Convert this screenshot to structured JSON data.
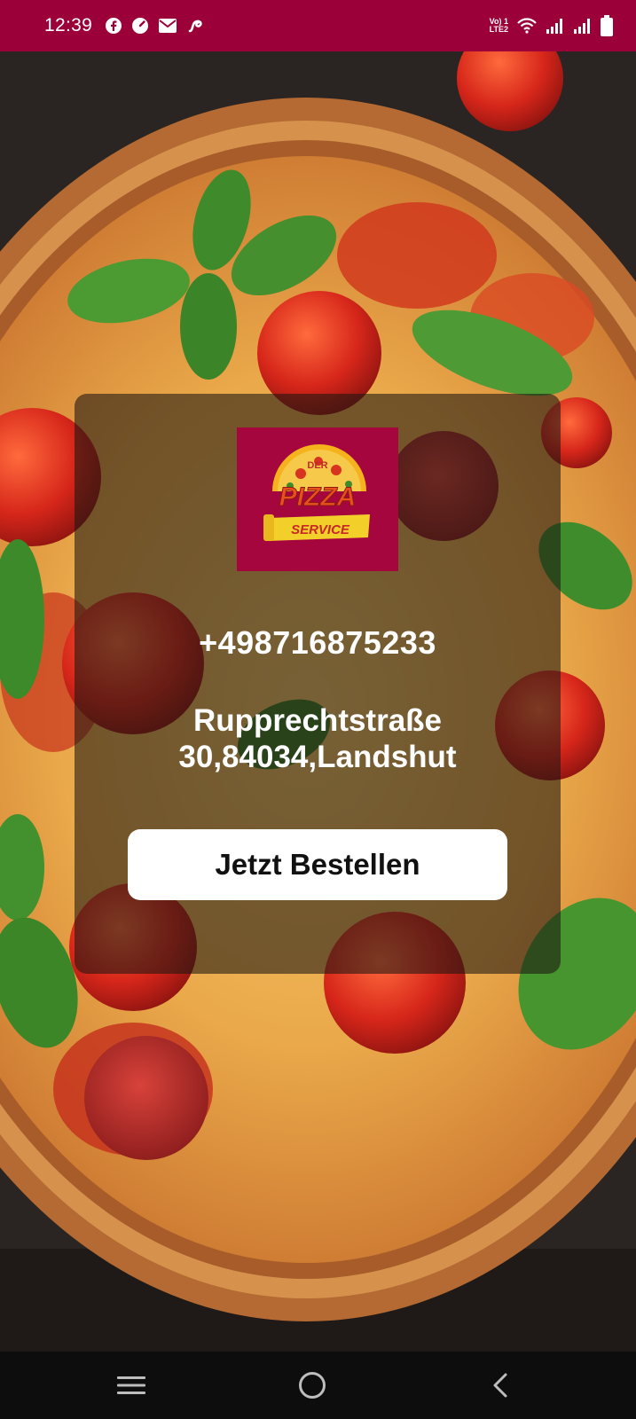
{
  "status_bar": {
    "time": "12:39",
    "notification_icons": [
      "facebook-icon",
      "speedometer-icon",
      "mail-icon",
      "swirl-app-icon"
    ],
    "network_label": "Vo) 1\nLTE2",
    "system_icons": [
      "wifi-icon",
      "signal-icon",
      "signal-icon",
      "battery-icon"
    ],
    "background_color": "#9b0038"
  },
  "logo": {
    "top_text": "DER",
    "brand_text": "PIZZA",
    "sub_text": "SERVICE",
    "background_color": "#a6063e"
  },
  "contact": {
    "phone": "+498716875233",
    "address_line1": "Rupprechtstraße",
    "address_line2": "30,84034,Landshut"
  },
  "order_button": {
    "label": "Jetzt Bestellen"
  },
  "nav_bar": {
    "buttons": [
      "menu-icon",
      "home-icon",
      "back-icon"
    ]
  },
  "colors": {
    "brand": "#9b0038",
    "card_overlay": "rgba(30,22,18,0.58)",
    "button_bg": "#ffffff",
    "text_light": "#ffffff"
  }
}
